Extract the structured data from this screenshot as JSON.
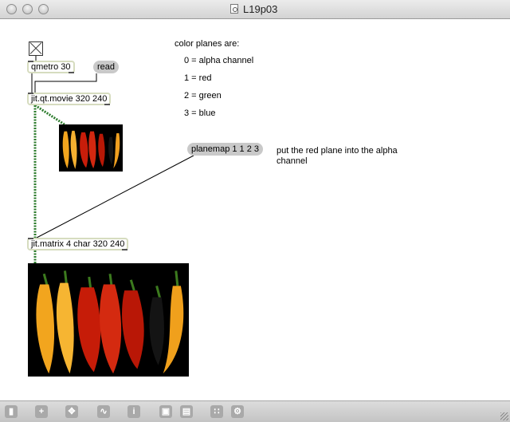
{
  "window": {
    "title": "L19p03"
  },
  "objects": {
    "qmetro": "qmetro 30",
    "read": "read",
    "qtmovie": "jit.qt.movie 320 240",
    "planemap": "planemap 1 1 2 3",
    "matrix": "jit.matrix 4 char 320 240"
  },
  "comments": {
    "heading": "color planes are:",
    "plane0": "0 = alpha channel",
    "plane1": "1 = red",
    "plane2": "2 = green",
    "plane3": "3 = blue",
    "planemap_note": "put the red plane into the alpha channel"
  },
  "icons": {
    "toolbar": [
      "lock-icon",
      "new-object-icon",
      "move-icon",
      "signal-icon",
      "info-icon",
      "window-icon",
      "window-small-icon",
      "grid-icon",
      "gear-icon"
    ]
  }
}
